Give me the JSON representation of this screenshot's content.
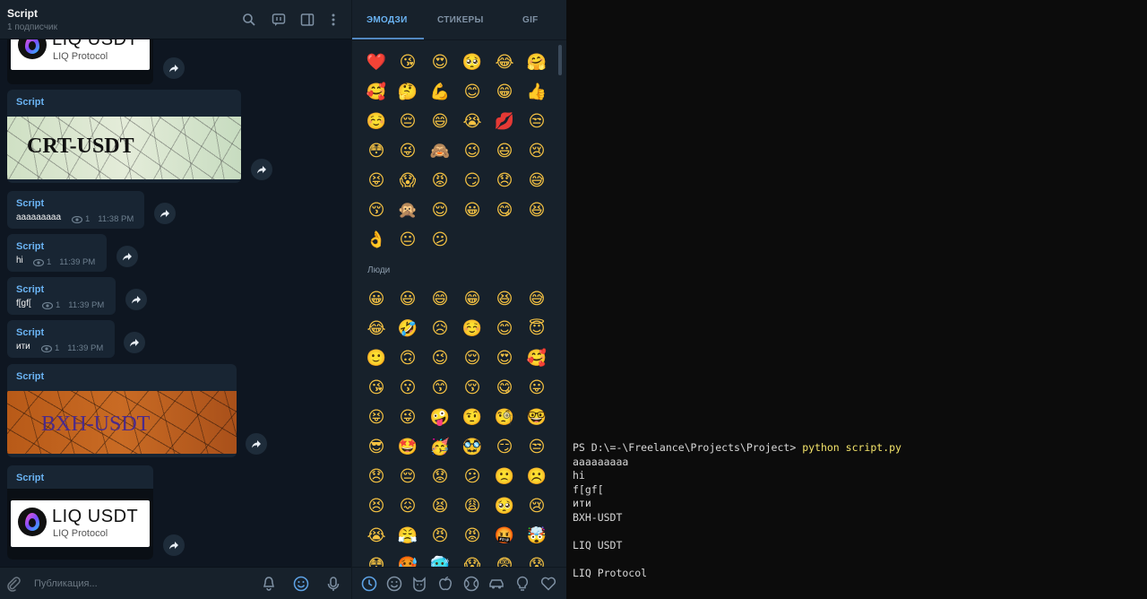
{
  "header": {
    "title": "Script",
    "subtitle": "1 подписчик"
  },
  "messages": [
    {
      "author": "",
      "image": "liq",
      "liq_title": "LIQ USDT",
      "liq_sub": "LIQ Protocol"
    },
    {
      "author": "Script",
      "image": "crt",
      "image_text": "CRT-USDT"
    },
    {
      "author": "Script",
      "text": "aaaaaaaaa",
      "views": "1",
      "time": "11:38 PM"
    },
    {
      "author": "Script",
      "text": "hi",
      "views": "1",
      "time": "11:39 PM"
    },
    {
      "author": "Script",
      "text": "f[gf[",
      "views": "1",
      "time": "11:39 PM"
    },
    {
      "author": "Script",
      "text": "ити",
      "views": "1",
      "time": "11:39 PM"
    },
    {
      "author": "Script",
      "image": "bxh",
      "image_text": "BXH-USDT"
    },
    {
      "author": "Script",
      "image": "liq",
      "liq_title": "LIQ USDT",
      "liq_sub": "LIQ Protocol"
    }
  ],
  "composer": {
    "placeholder": "Публикация..."
  },
  "emoji_panel": {
    "tabs": [
      "ЭМОДЗИ",
      "СТИКЕРЫ",
      "GIF"
    ],
    "active_tab": "ЭМОДЗИ",
    "category_people": "Люди",
    "recent": [
      "❤️",
      "😘",
      "😍",
      "🥺",
      "😂",
      "🤗",
      "🥰",
      "🤔",
      "💪",
      "😊",
      "😁",
      "👍",
      "☺️",
      "😔",
      "😄",
      "😭",
      "💋",
      "😒",
      "😳",
      "😜",
      "🙈",
      "😉",
      "😃",
      "😢",
      "😝",
      "😱",
      "😡",
      "😏",
      "😞",
      "😅",
      "😚",
      "🙊",
      "😌",
      "😀",
      "😋",
      "😆",
      "👌",
      "😐",
      "😕"
    ],
    "people": [
      "😀",
      "😃",
      "😄",
      "😁",
      "😆",
      "😅",
      "😂",
      "🤣",
      "😥",
      "☺️",
      "😊",
      "😇",
      "🙂",
      "🙃",
      "😉",
      "😌",
      "😍",
      "🥰",
      "😘",
      "😗",
      "😙",
      "😚",
      "😋",
      "😛",
      "😝",
      "😜",
      "🤪",
      "🤨",
      "🧐",
      "🤓",
      "😎",
      "🤩",
      "🥳",
      "🥸",
      "😏",
      "😒",
      "😞",
      "😔",
      "😟",
      "😕",
      "🙁",
      "☹️",
      "😣",
      "😖",
      "😫",
      "😩",
      "🥺",
      "😢",
      "😭",
      "😤",
      "😠",
      "😡",
      "🤬",
      "🤯",
      "😳",
      "🥵",
      "🥶",
      "😱",
      "😨",
      "😰"
    ],
    "category_icons": [
      "recent-icon",
      "smile-icon",
      "cat-icon",
      "apple-icon",
      "ball-icon",
      "car-icon",
      "bulb-icon",
      "heart-icon"
    ]
  },
  "terminal": {
    "prompt": "PS D:\\=-\\Freelance\\Projects\\Project> ",
    "command": "python script.py",
    "output": [
      "aaaaaaaaa",
      "hi",
      "f[gf[",
      "ити",
      "BXH-USDT",
      "",
      "LIQ USDT",
      "",
      "LIQ Protocol"
    ]
  },
  "colors": {
    "chat_bg": "#0e1621",
    "bubble": "#182533",
    "accent": "#6ab3f3",
    "panel": "#17212b",
    "terminal_bg": "#0c0c0c"
  }
}
